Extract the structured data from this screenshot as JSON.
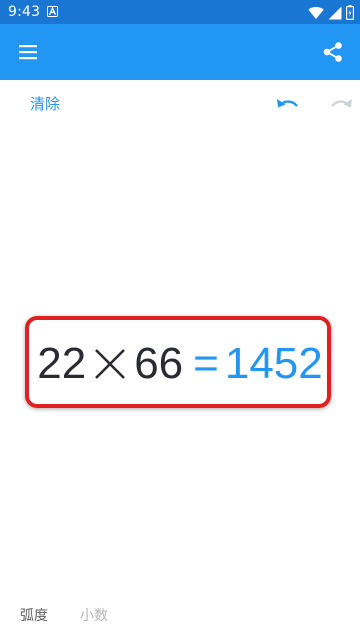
{
  "status_bar": {
    "time": "9:43",
    "icons": [
      "a-icon",
      "wifi-icon",
      "signal-icon",
      "battery-icon"
    ]
  },
  "app_bar": {
    "color": "#2196f3",
    "icons": [
      "menu-icon",
      "share-icon"
    ]
  },
  "toolbar": {
    "clear_label": "清除",
    "icons": [
      "undo-icon",
      "redo-icon"
    ]
  },
  "expression": {
    "operand_1": "22",
    "operator_icon": "multiply-icon",
    "operand_2": "66",
    "equals": "=",
    "result": "1452"
  },
  "modes": {
    "radian_label": "弧度",
    "decimal_label": "小数"
  },
  "colors": {
    "primary": "#2196f3",
    "status_bar": "#1976d2",
    "highlight_border": "#e02121",
    "expression_text": "#2a2a34"
  }
}
